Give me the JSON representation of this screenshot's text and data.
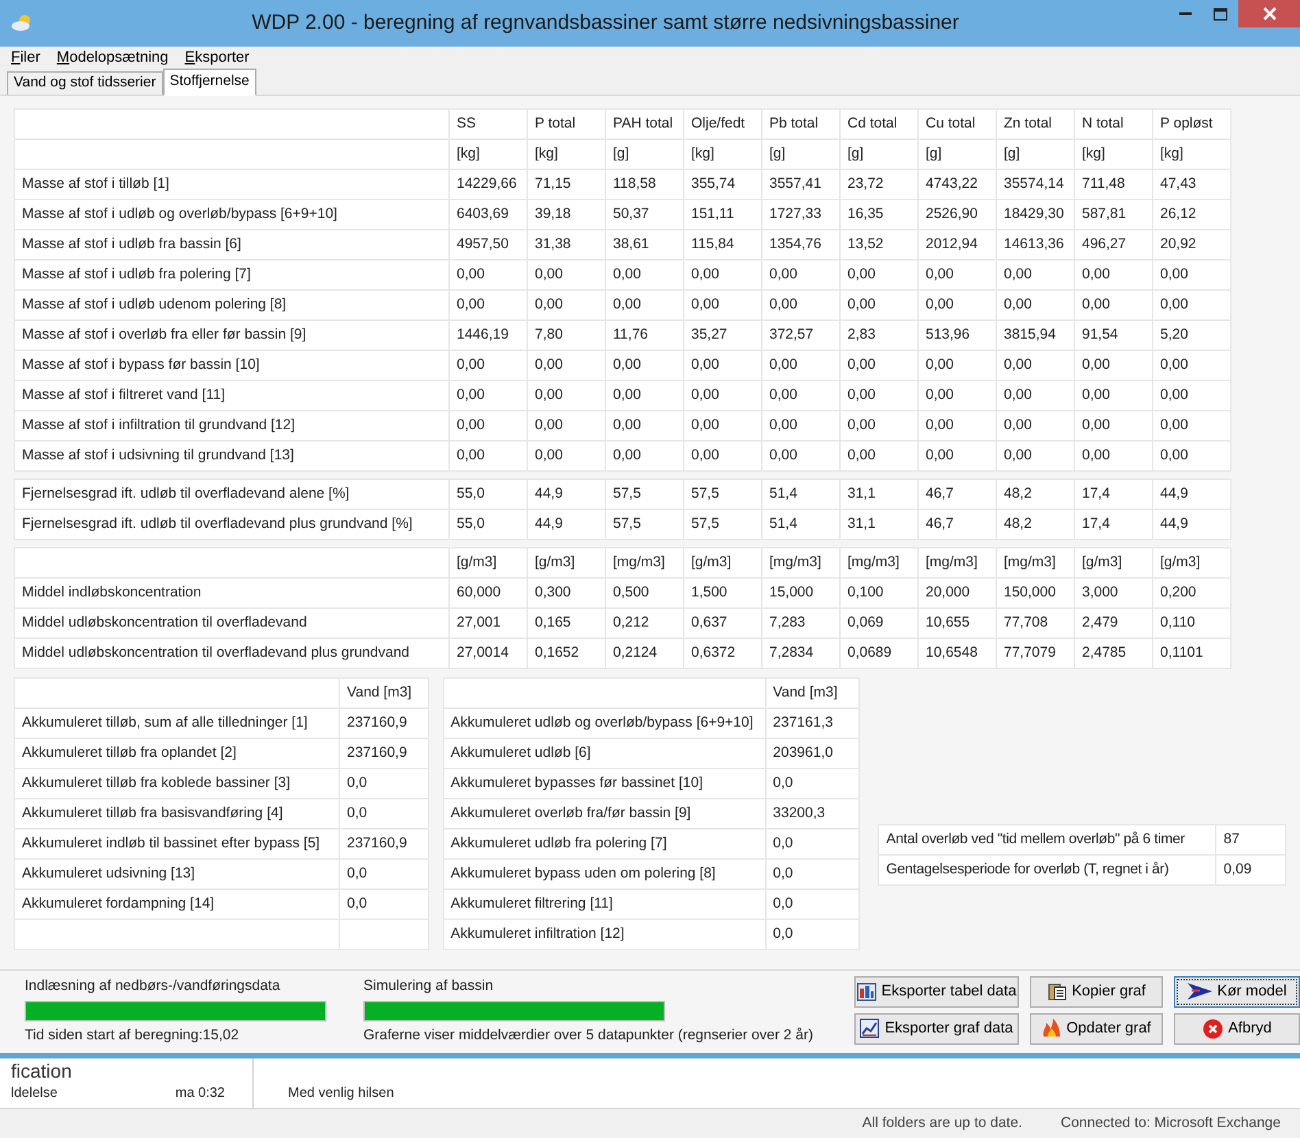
{
  "window": {
    "title": "WDP 2.00 - beregning af regnvandsbassiner samt større nedsivningsbassiner"
  },
  "menu": [
    "Filer",
    "Modelopsætning",
    "Eksporter"
  ],
  "tabs": [
    {
      "label": "Vand og stof tidsserier",
      "selected": false
    },
    {
      "label": "Stoffjernelse",
      "selected": true
    }
  ],
  "mass_table": {
    "columns": [
      "SS",
      "P total",
      "PAH total",
      "Olje/fedt",
      "Pb total",
      "Cd total",
      "Cu total",
      "Zn total",
      "N total",
      "P opløst"
    ],
    "units": [
      "[kg]",
      "[kg]",
      "[g]",
      "[kg]",
      "[g]",
      "[g]",
      "[g]",
      "[g]",
      "[kg]",
      "[kg]"
    ],
    "rows": [
      {
        "label": "Masse af stof i tilløb [1]",
        "values": [
          "14229,66",
          "71,15",
          "118,58",
          "355,74",
          "3557,41",
          "23,72",
          "4743,22",
          "35574,14",
          "711,48",
          "47,43"
        ]
      },
      {
        "label": "Masse af stof i udløb og overløb/bypass [6+9+10]",
        "values": [
          "6403,69",
          "39,18",
          "50,37",
          "151,11",
          "1727,33",
          "16,35",
          "2526,90",
          "18429,30",
          "587,81",
          "26,12"
        ]
      },
      {
        "label": "Masse af stof i udløb fra bassin [6]",
        "values": [
          "4957,50",
          "31,38",
          "38,61",
          "115,84",
          "1354,76",
          "13,52",
          "2012,94",
          "14613,36",
          "496,27",
          "20,92"
        ]
      },
      {
        "label": "Masse af stof i udløb fra polering [7]",
        "values": [
          "0,00",
          "0,00",
          "0,00",
          "0,00",
          "0,00",
          "0,00",
          "0,00",
          "0,00",
          "0,00",
          "0,00"
        ]
      },
      {
        "label": "Masse af stof i udløb udenom polering [8]",
        "values": [
          "0,00",
          "0,00",
          "0,00",
          "0,00",
          "0,00",
          "0,00",
          "0,00",
          "0,00",
          "0,00",
          "0,00"
        ]
      },
      {
        "label": "Masse af stof i overløb fra eller før bassin [9]",
        "values": [
          "1446,19",
          "7,80",
          "11,76",
          "35,27",
          "372,57",
          "2,83",
          "513,96",
          "3815,94",
          "91,54",
          "5,20"
        ]
      },
      {
        "label": "Masse af stof i bypass før bassin [10]",
        "values": [
          "0,00",
          "0,00",
          "0,00",
          "0,00",
          "0,00",
          "0,00",
          "0,00",
          "0,00",
          "0,00",
          "0,00"
        ]
      },
      {
        "label": "Masse af stof i filtreret vand [11]",
        "values": [
          "0,00",
          "0,00",
          "0,00",
          "0,00",
          "0,00",
          "0,00",
          "0,00",
          "0,00",
          "0,00",
          "0,00"
        ]
      },
      {
        "label": "Masse af stof i infiltration til grundvand [12]",
        "values": [
          "0,00",
          "0,00",
          "0,00",
          "0,00",
          "0,00",
          "0,00",
          "0,00",
          "0,00",
          "0,00",
          "0,00"
        ]
      },
      {
        "label": "Masse af stof i udsivning til grundvand [13]",
        "values": [
          "0,00",
          "0,00",
          "0,00",
          "0,00",
          "0,00",
          "0,00",
          "0,00",
          "0,00",
          "0,00",
          "0,00"
        ]
      }
    ]
  },
  "removal_table": {
    "rows": [
      {
        "label": "Fjernelsesgrad ift. udløb til overfladevand alene [%]",
        "values": [
          "55,0",
          "44,9",
          "57,5",
          "57,5",
          "51,4",
          "31,1",
          "46,7",
          "48,2",
          "17,4",
          "44,9"
        ]
      },
      {
        "label": "Fjernelsesgrad ift. udløb til overfladevand plus grundvand [%]",
        "values": [
          "55,0",
          "44,9",
          "57,5",
          "57,5",
          "51,4",
          "31,1",
          "46,7",
          "48,2",
          "17,4",
          "44,9"
        ]
      }
    ]
  },
  "concentration_table": {
    "units": [
      "[g/m3]",
      "[g/m3]",
      "[mg/m3]",
      "[g/m3]",
      "[mg/m3]",
      "[mg/m3]",
      "[mg/m3]",
      "[mg/m3]",
      "[g/m3]",
      "[g/m3]"
    ],
    "rows": [
      {
        "label": "Middel indløbskoncentration",
        "values": [
          "60,000",
          "0,300",
          "0,500",
          "1,500",
          "15,000",
          "0,100",
          "20,000",
          "150,000",
          "3,000",
          "0,200"
        ]
      },
      {
        "label": "Middel udløbskoncentration til overfladevand",
        "values": [
          "27,001",
          "0,165",
          "0,212",
          "0,637",
          "7,283",
          "0,069",
          "10,655",
          "77,708",
          "2,479",
          "0,110"
        ]
      },
      {
        "label": "Middel udløbskoncentration til overfladevand plus grundvand",
        "values": [
          "27,0014",
          "0,1652",
          "0,2124",
          "0,6372",
          "7,2834",
          "0,0689",
          "10,6548",
          "77,7079",
          "2,4785",
          "0,1101"
        ]
      }
    ]
  },
  "inflow_table": {
    "column": "Vand [m3]",
    "rows": [
      {
        "label": "Akkumuleret tilløb, sum af alle tilledninger [1]",
        "value": "237160,9"
      },
      {
        "label": "Akkumuleret tilløb fra oplandet [2]",
        "value": "237160,9"
      },
      {
        "label": "Akkumuleret tilløb fra koblede bassiner [3]",
        "value": "0,0"
      },
      {
        "label": "Akkumuleret tilløb fra basisvandføring [4]",
        "value": "0,0"
      },
      {
        "label": "Akkumuleret indløb til bassinet efter bypass [5]",
        "value": "237160,9"
      },
      {
        "label": "Akkumuleret udsivning [13]",
        "value": "0,0"
      },
      {
        "label": "Akkumuleret fordampning [14]",
        "value": "0,0"
      }
    ]
  },
  "outflow_table": {
    "column": "Vand [m3]",
    "rows": [
      {
        "label": "Akkumuleret udløb og overløb/bypass [6+9+10]",
        "value": "237161,3"
      },
      {
        "label": "Akkumuleret udløb [6]",
        "value": "203961,0"
      },
      {
        "label": "Akkumuleret bypasses før bassinet [10]",
        "value": "0,0"
      },
      {
        "label": "Akkumuleret overløb fra/før bassin [9]",
        "value": "33200,3"
      },
      {
        "label": "Akkumuleret udløb fra polering [7]",
        "value": "0,0"
      },
      {
        "label": "Akkumuleret bypass uden om polering [8]",
        "value": "0,0"
      },
      {
        "label": "Akkumuleret filtrering [11]",
        "value": "0,0"
      },
      {
        "label": "Akkumuleret infiltration [12]",
        "value": "0,0"
      }
    ]
  },
  "overflow_table": {
    "rows": [
      {
        "label": "Antal overløb ved \"tid mellem overløb\" på 6 timer",
        "value": "87"
      },
      {
        "label": "Gentagelsesperiode for overløb (T, regnet i år)",
        "value": "0,09"
      }
    ]
  },
  "progress": [
    {
      "label": "Indlæsning af nedbørs-/vandføringsdata",
      "level": 1,
      "note": "Tid siden start af beregning:15,02"
    },
    {
      "label": "Simulering af bassin",
      "level": 1,
      "note": "Graferne viser middelværdier over 5 datapunkter (regnserier over 2 år)"
    }
  ],
  "buttons": [
    {
      "label": "Eksporter tabel data",
      "kind": "table",
      "focused": false
    },
    {
      "label": "Kopier graf",
      "kind": "copy",
      "focused": false
    },
    {
      "label": "Kør model",
      "kind": "run",
      "focused": true
    },
    {
      "label": "Eksporter graf data",
      "kind": "chart",
      "focused": false
    },
    {
      "label": "Opdater graf",
      "kind": "refresh",
      "focused": false
    },
    {
      "label": "Afbryd",
      "kind": "stop",
      "focused": false
    }
  ],
  "background_window": {
    "heading": "fication",
    "item": "ldelelse",
    "time": "ma 0:32",
    "preview": "Med venlig hilsen"
  },
  "status_bar": [
    "All folders are up to date.",
    "Connected to: Microsoft Exchange"
  ]
}
